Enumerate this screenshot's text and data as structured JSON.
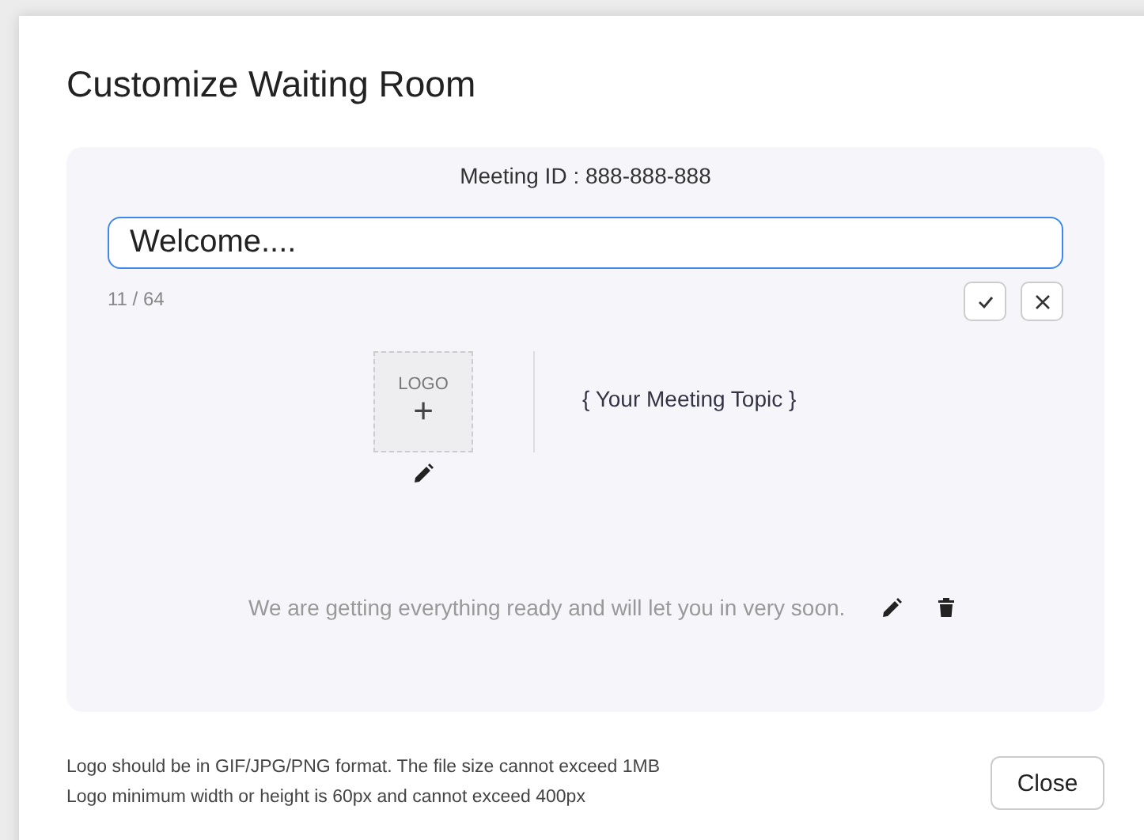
{
  "dialog": {
    "title": "Customize Waiting Room"
  },
  "preview": {
    "meeting_id": "Meeting ID : 888-888-888",
    "title_field": {
      "value": "Welcome....",
      "counter": "11 / 64"
    },
    "logo": {
      "label": "LOGO",
      "glyph": "+"
    },
    "topic": "{ Your Meeting Topic }",
    "message": "We are getting everything ready and will let you in very soon."
  },
  "notes": [
    "Logo should be in GIF/JPG/PNG format. The file size cannot exceed 1MB",
    "Logo minimum width or height is 60px and cannot exceed 400px"
  ],
  "buttons": [
    "Close"
  ]
}
